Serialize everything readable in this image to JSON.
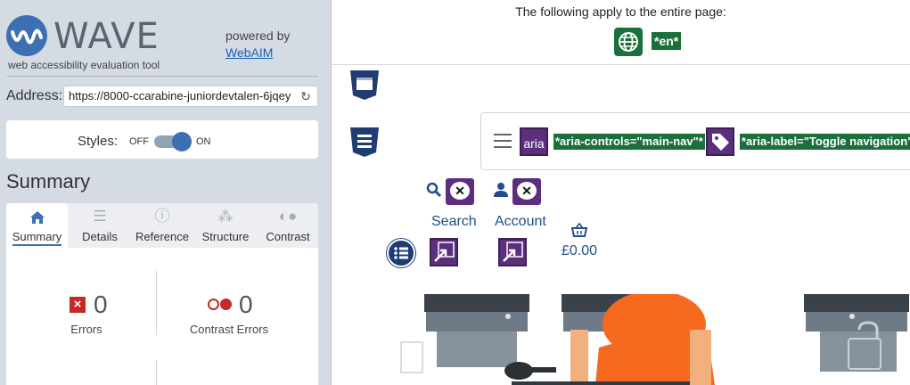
{
  "wave": {
    "title": "WAVE",
    "subtitle": "web accessibility evaluation tool",
    "powered_by": "powered by",
    "webaim_link": "WebAIM",
    "address_label": "Address:",
    "address_value": "https://8000-ccarabine-juniordevtalen-6jqey",
    "styles_label": "Styles:",
    "styles_off": "OFF",
    "styles_on": "ON",
    "summary_heading": "Summary",
    "tabs": [
      {
        "label": "Summary",
        "icon": "home-icon",
        "active": true
      },
      {
        "label": "Details",
        "icon": "list-icon",
        "active": false
      },
      {
        "label": "Reference",
        "icon": "info-icon",
        "active": false
      },
      {
        "label": "Structure",
        "icon": "sitemap-icon",
        "active": false
      },
      {
        "label": "Contrast",
        "icon": "contrast-icon",
        "active": false
      }
    ],
    "stats": {
      "errors_count": "0",
      "errors_label": "Errors",
      "contrast_count": "0",
      "contrast_label": "Contrast Errors"
    }
  },
  "preview": {
    "apply_text": "The following apply to the entire page:",
    "lang_badge": "*en*",
    "aria_controls_badge": "*aria-controls=\"main-nav\"*",
    "aria_label_badge": "*aria-label=\"Toggle navigation\"*",
    "aria_icon_text": "aria",
    "search_label": "Search",
    "account_label": "Account",
    "price": "£0.00"
  },
  "colors": {
    "wave_blue": "#3d70b2",
    "error_red": "#c62828",
    "feature_green": "#1b6f3b",
    "aria_purple": "#5b2f7e",
    "structure_blue": "#1f3d73"
  }
}
